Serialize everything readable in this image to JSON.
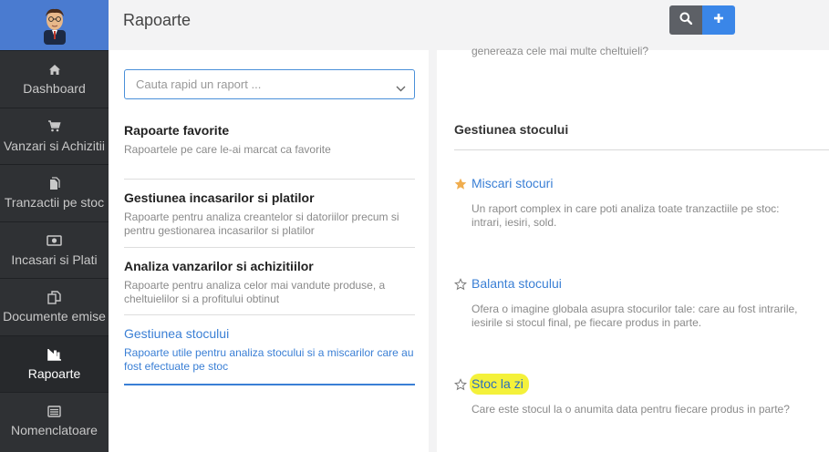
{
  "header": {
    "title": "Rapoarte"
  },
  "sidebar": {
    "items": [
      {
        "label": "Dashboard",
        "icon": "home-icon"
      },
      {
        "label": "Vanzari si Achizitii",
        "icon": "cart-icon"
      },
      {
        "label": "Tranzactii pe stoc",
        "icon": "document-icon"
      },
      {
        "label": "Incasari si Plati",
        "icon": "money-icon"
      },
      {
        "label": "Documente emise",
        "icon": "copy-icon"
      },
      {
        "label": "Rapoarte",
        "icon": "bar-chart-icon"
      },
      {
        "label": "Nomenclatoare",
        "icon": "list-icon"
      }
    ],
    "active_index": 5
  },
  "search": {
    "placeholder": "Cauta rapid un raport ..."
  },
  "categories": [
    {
      "title": "Rapoarte favorite",
      "description": "Rapoartele pe care le-ai marcat ca favorite"
    },
    {
      "title": "Gestiunea incasarilor si platilor",
      "description": "Rapoarte pentru analiza creantelor si datoriilor precum si pentru gestionarea incasarilor si platilor"
    },
    {
      "title": "Analiza vanzarilor si achizitiilor",
      "description": "Rapoarte pentru analiza celor mai vandute produse, a cheltuielilor si a profitului obtinut"
    },
    {
      "title": "Gestiunea stocului",
      "description": "Rapoarte utile pentru analiza stocului si a miscarilor care au fost efectuate pe stoc"
    }
  ],
  "active_category_index": 3,
  "right": {
    "cut_text": "genereaza cele mai multe cheltuieli?",
    "section_title": "Gestiunea stocului",
    "reports": [
      {
        "name": "Miscari stocuri",
        "description": "Un raport complex in care poti analiza toate tranzactiile pe stoc: intrari, iesiri, sold.",
        "favorite": true
      },
      {
        "name": "Balanta stocului",
        "description": "Ofera o imagine globala asupra stocurilor tale: care au fost intrarile, iesirile si stocul final, pe fiecare produs in parte.",
        "favorite": false
      },
      {
        "name": "Stoc la zi",
        "description": "Care este stocul la o anumita data pentru fiecare produs in parte?",
        "favorite": false,
        "highlighted": true
      }
    ]
  },
  "colors": {
    "accent": "#3a7fd5",
    "sidebar": "#2f3134",
    "logo_bg": "#4a7bd0",
    "highlight": "#f4f13a",
    "star_filled": "#f0ad4e"
  }
}
